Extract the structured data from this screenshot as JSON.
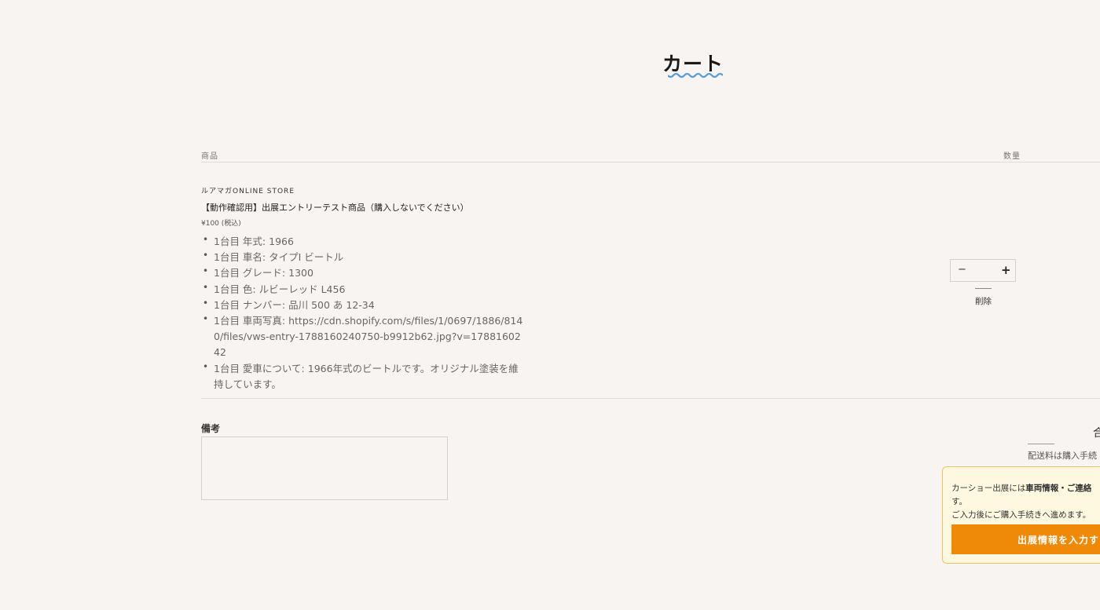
{
  "page": {
    "title": "カート"
  },
  "table": {
    "header_product": "商品",
    "header_quantity": "数量"
  },
  "item": {
    "vendor": "ルアマガONLINE STORE",
    "title": "【動作確認用】出展エントリーテスト商品（購入しないでください）",
    "price": "¥100 (税込)",
    "properties": [
      "1台目 年式: 1966",
      "1台目 車名: タイプⅠ ビートル",
      "1台目 グレード: 1300",
      "1台目 色: ルビーレッド L456",
      "1台目 ナンバー: 品川 500 あ 12-34",
      "1台目 車両写真: https://cdn.shopify.com/s/files/1/0697/1886/8140/files/vws-entry-1788160240750-b9912b62.jpg?v=1788160242",
      "1台目 愛車について: 1966年式のビートルです。オリジナル塗装を維持しています。"
    ],
    "quantity": {
      "minus_symbol": "−",
      "plus_symbol": "+",
      "value": ""
    },
    "remove_label": "削除"
  },
  "note": {
    "label": "備考",
    "value": ""
  },
  "summary": {
    "total_label": "合",
    "shipping_text": "配送料は購入手続"
  },
  "notice": {
    "line1_prefix": "カーショー出展には",
    "line1_bold": "車両情報・ご連絡",
    "line2": "す。",
    "line3": "ご入力後にご購入手続きへ進めます。",
    "button_label": "出展情報を入力す",
    "accent_color": "#ef8a08",
    "border_color": "#f0c25e"
  }
}
